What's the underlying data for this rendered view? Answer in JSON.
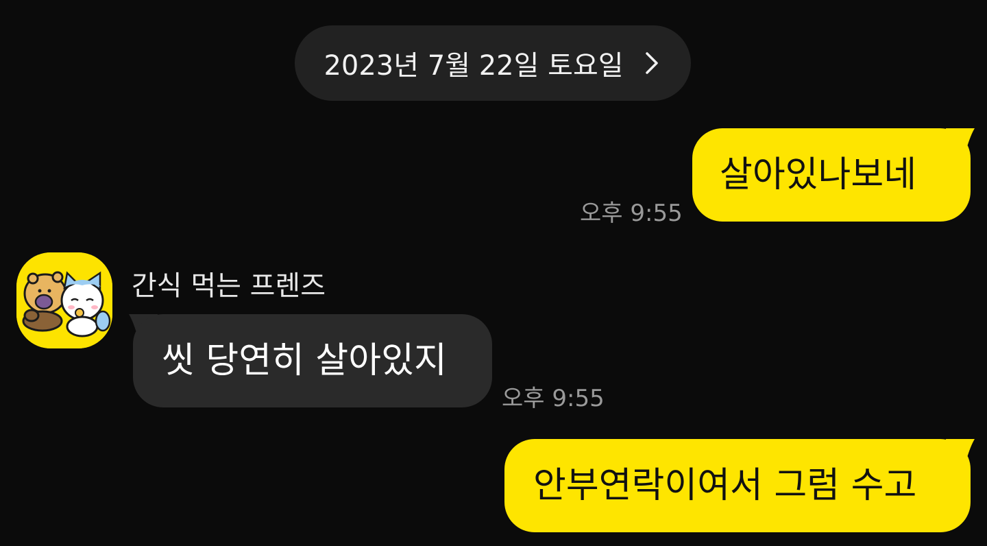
{
  "date_pill": {
    "label": "2023년 7월 22일 토요일",
    "icon": "chevron-right-icon"
  },
  "messages": [
    {
      "sender": "me",
      "text": "살아있나보네",
      "time": "오후 9:55"
    },
    {
      "sender": "other",
      "sender_name": "간식 먹는 프렌즈",
      "text": "씻 당연히 살아있지",
      "time": "오후 9:55",
      "avatar": "friends-avatar-icon"
    },
    {
      "sender": "me",
      "text": "안부연락이여서 그럼 수고"
    }
  ],
  "colors": {
    "background": "#0b0b0b",
    "my_bubble": "#fee500",
    "other_bubble": "#2a2a2a",
    "date_pill": "#222222",
    "time_text": "#9a9a9a"
  }
}
